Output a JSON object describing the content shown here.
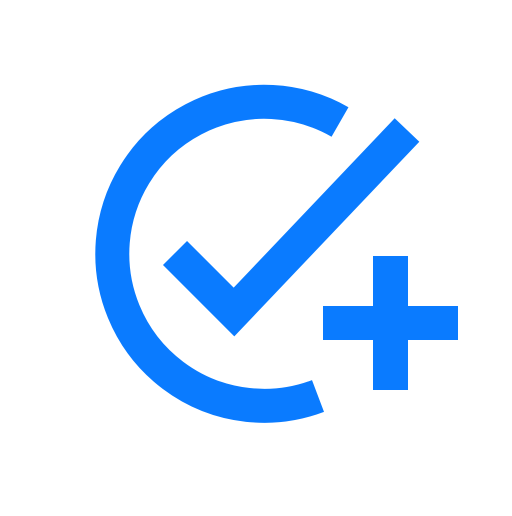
{
  "icon": {
    "name": "check-circle-add-icon",
    "accent_color": "#0A7BFF",
    "background_color": "#FFFFFF"
  }
}
